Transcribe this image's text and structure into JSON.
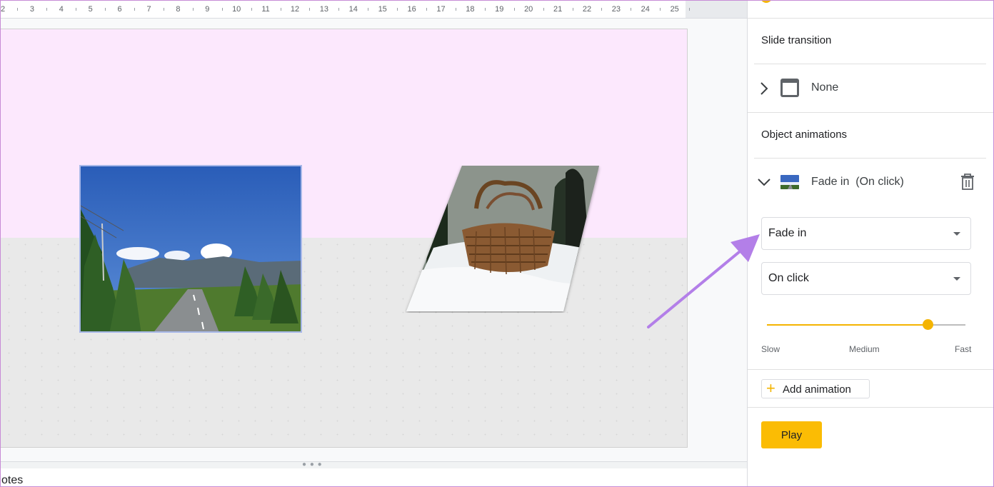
{
  "ruler": {
    "numbers": [
      "2",
      "3",
      "4",
      "5",
      "6",
      "7",
      "8",
      "9",
      "10",
      "11",
      "12",
      "13",
      "14",
      "15",
      "16",
      "17",
      "18",
      "19",
      "20",
      "21",
      "22",
      "23",
      "24",
      "25"
    ]
  },
  "slide": {
    "images": [
      {
        "name": "road-mountains-photo"
      },
      {
        "name": "basket-snow-photo"
      }
    ]
  },
  "notes": {
    "label": "otes"
  },
  "panel": {
    "slide_transition_title": "Slide transition",
    "transition_value": "None",
    "object_animations_title": "Object animations",
    "animation_item": {
      "effect": "Fade in",
      "trigger": "(On click)"
    },
    "effect_select": {
      "value": "Fade in"
    },
    "trigger_select": {
      "value": "On click"
    },
    "speed": {
      "slow": "Slow",
      "medium": "Medium",
      "fast": "Fast",
      "level": 0.81
    },
    "add_animation_label": "Add animation",
    "play_label": "Play"
  },
  "colors": {
    "accent": "#fbbc04",
    "arrow": "#b37fe8",
    "slide_top": "#fce8fd"
  }
}
